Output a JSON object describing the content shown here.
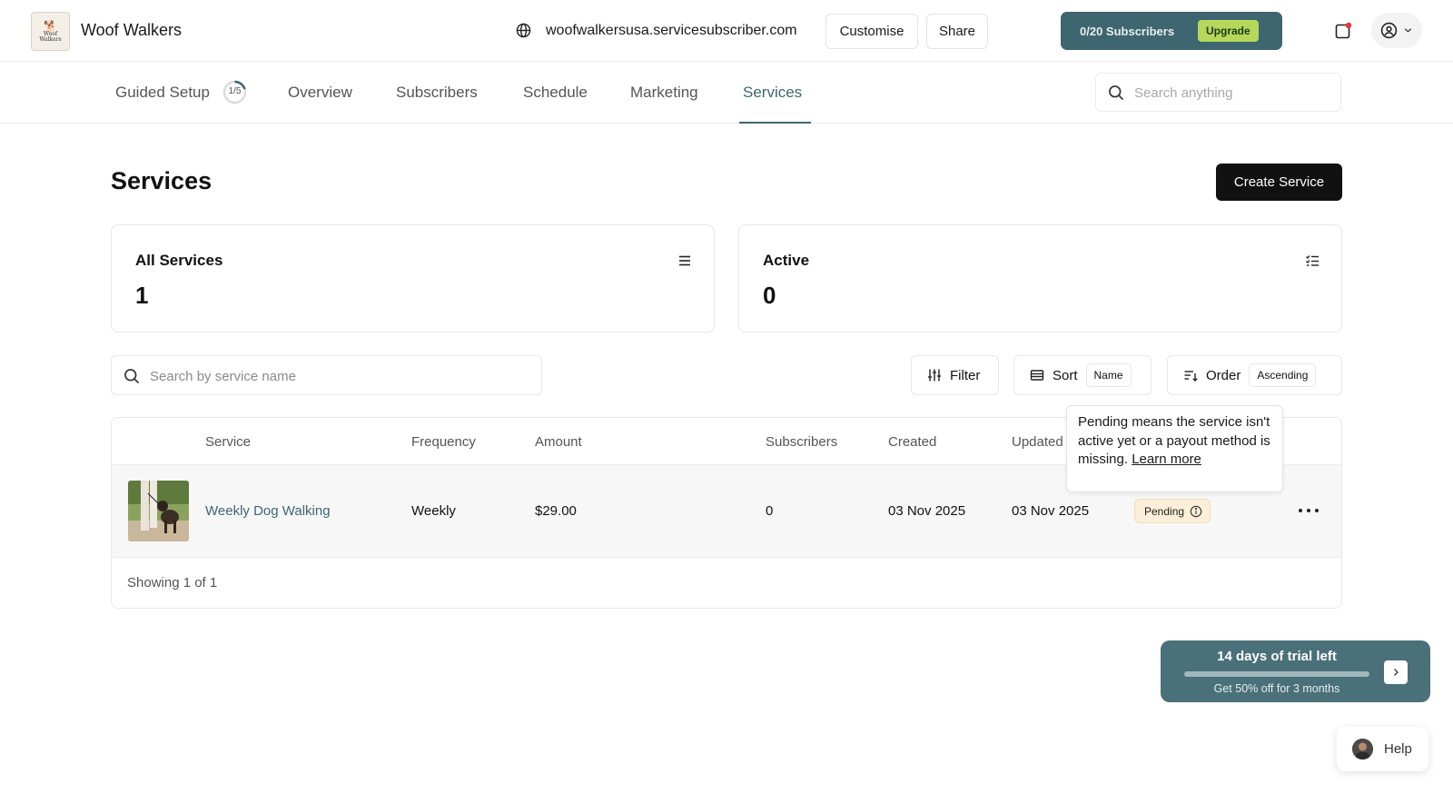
{
  "app": {
    "brand": "Woof Walkers",
    "logo_text": "Woof Walkers",
    "url": "woofwalkersusa.servicesubscriber.com",
    "customise_label": "Customise",
    "share_label": "Share",
    "subscribers_usage": "0/20 Subscribers",
    "upgrade_label": "Upgrade",
    "accent_color": "#3e6670",
    "notification_dot_color": "#e53935"
  },
  "nav": {
    "guided_setup": "Guided Setup",
    "guided_step": "1/5",
    "guided_progress": 0.2,
    "tabs": [
      "Overview",
      "Subscribers",
      "Schedule",
      "Marketing",
      "Services"
    ],
    "active_tab": "Services",
    "search_placeholder": "Search anything"
  },
  "page": {
    "title": "Services",
    "create_label": "Create Service"
  },
  "stats": {
    "all": {
      "label": "All Services",
      "value": "1",
      "icon": "list-icon"
    },
    "active": {
      "label": "Active",
      "value": "0",
      "icon": "checklist-icon"
    }
  },
  "toolbar": {
    "search_placeholder": "Search by service name",
    "filter_label": "Filter",
    "sort_label": "Sort",
    "sort_value": "Name",
    "order_label": "Order",
    "order_value": "Ascending"
  },
  "table": {
    "columns": [
      "Service",
      "Frequency",
      "Amount",
      "Subscribers",
      "Created",
      "Updated"
    ],
    "rows": [
      {
        "service": "Weekly Dog Walking",
        "frequency": "Weekly",
        "amount": "$29.00",
        "subscribers": "0",
        "created": "03 Nov 2025",
        "updated": "03 Nov 2025",
        "status": "Pending"
      }
    ],
    "footer": "Showing 1 of 1"
  },
  "tooltip": {
    "text": "Pending means the service isn't active yet or a payout method is missing.",
    "link": "Learn more"
  },
  "trial": {
    "title": "14 days of trial left",
    "offer": "Get 50% off for 3 months",
    "progress": 0.0
  },
  "help": {
    "label": "Help"
  }
}
